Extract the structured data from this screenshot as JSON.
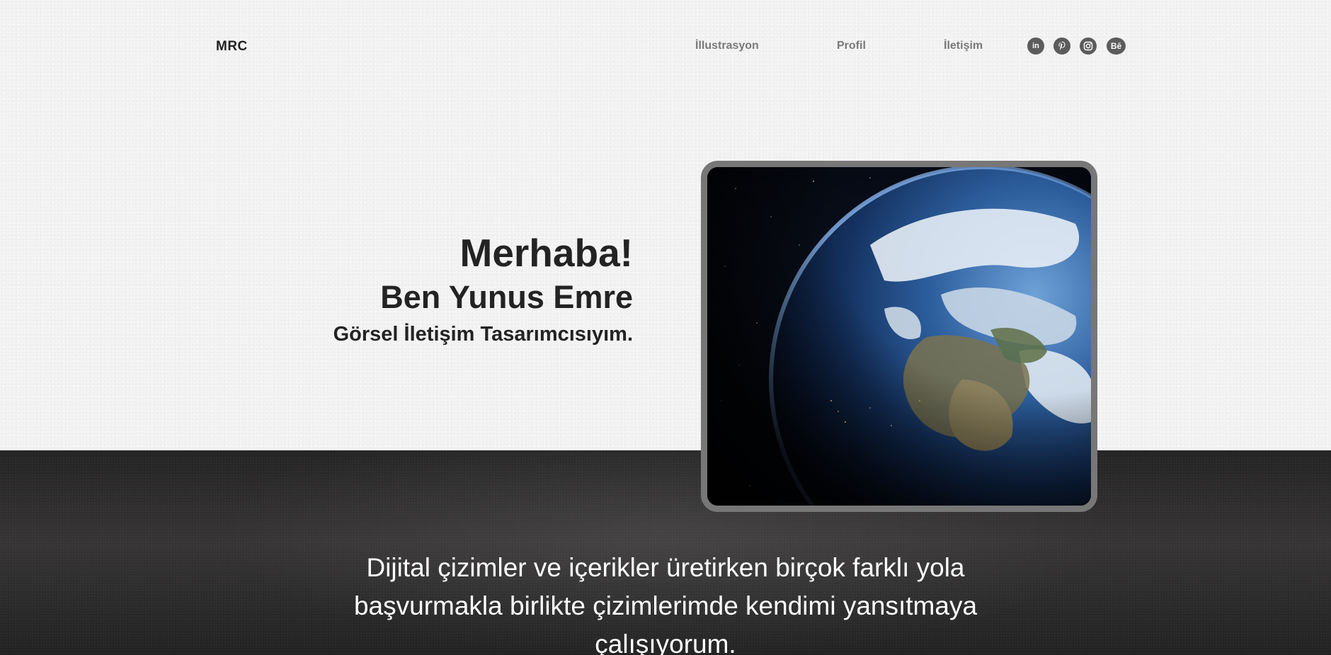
{
  "brand": {
    "logo": "MRC"
  },
  "nav": {
    "items": [
      "İllustrasyon",
      "Profil",
      "İletişim"
    ]
  },
  "social": {
    "icons": [
      "linkedin-icon",
      "pinterest-icon",
      "instagram-icon",
      "behance-icon"
    ],
    "linkedin_label": "in",
    "behance_label": "Bē"
  },
  "hero": {
    "greeting": "Merhaba!",
    "name": "Ben Yunus Emre",
    "role": "Görsel İletişim Tasarımcısıyım.",
    "image": "earth-from-space"
  },
  "intro": {
    "text": "Dijital çizimler ve içerikler üretirken birçok farklı yola başvurmakla birlikte çizimlerimde kendimi yansıtmaya çalışıyorum."
  },
  "colors": {
    "text_dark": "#232323",
    "nav_text": "#7a7a7a",
    "dark_section": "#2a2929",
    "frame_border": "#777777"
  }
}
